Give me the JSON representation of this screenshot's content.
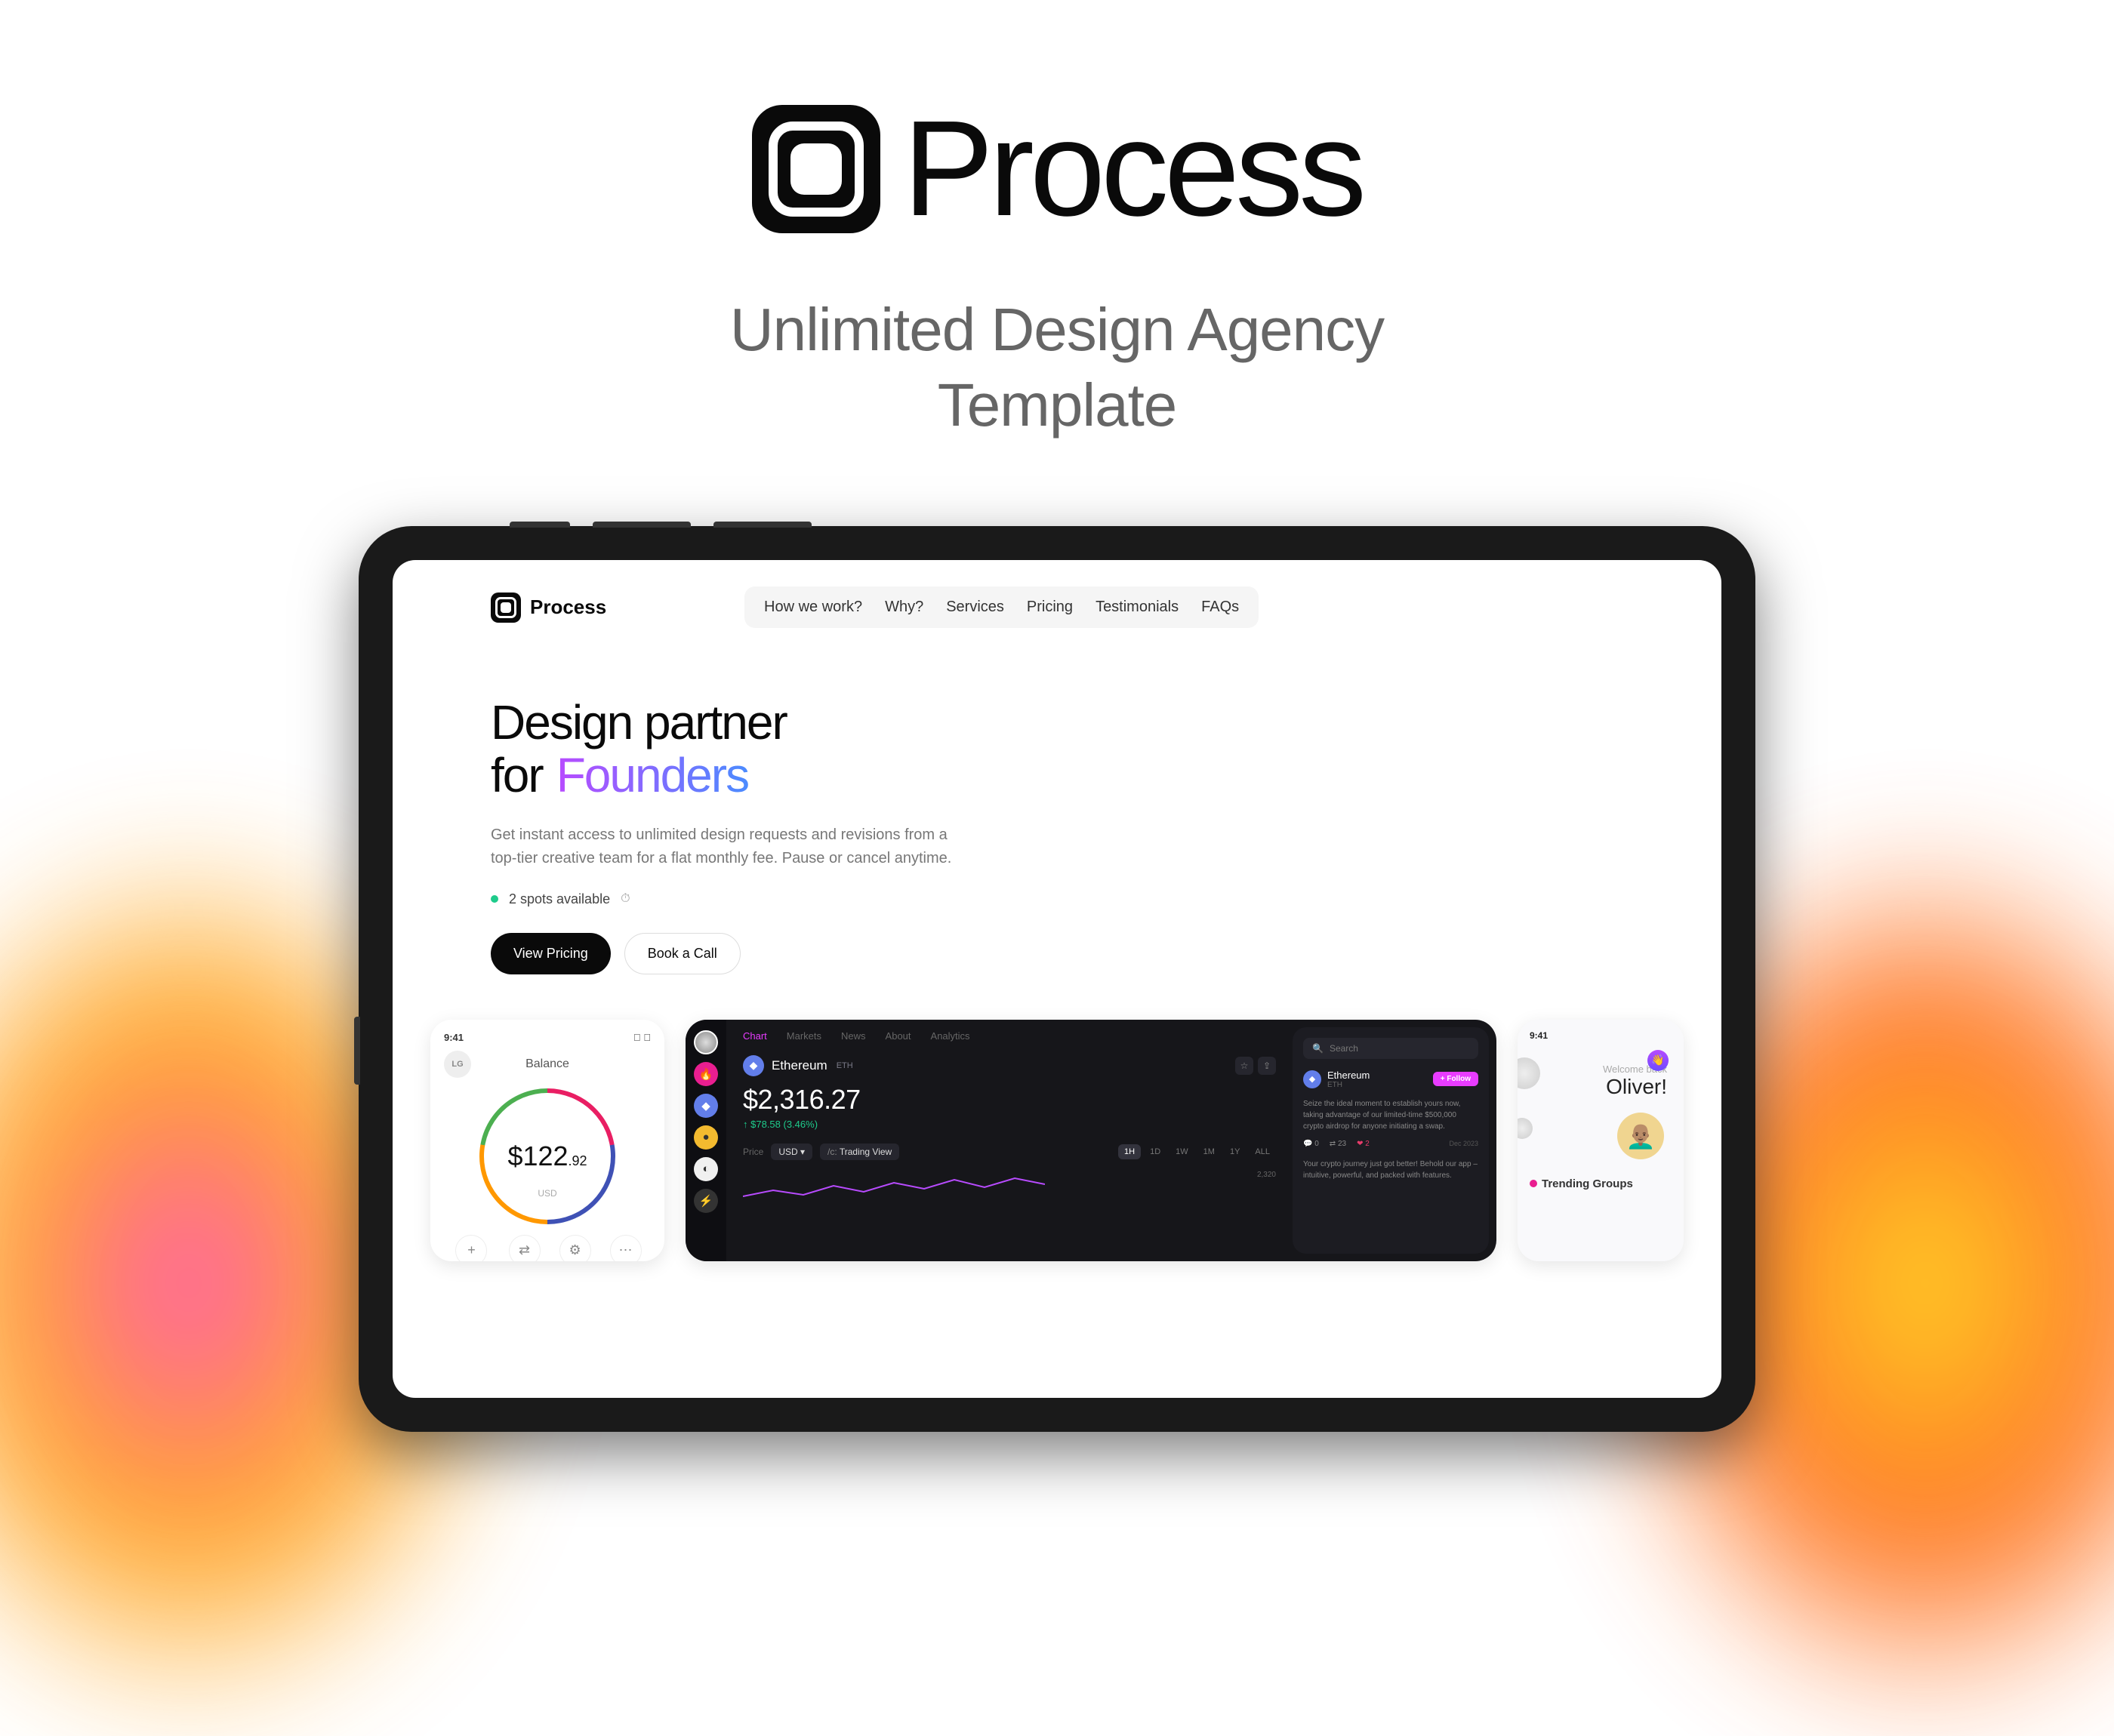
{
  "hero": {
    "brand": "Process",
    "subtitle_line1": "Unlimited Design Agency",
    "subtitle_line2": "Template"
  },
  "site": {
    "brand": "Process",
    "nav": [
      "How we work?",
      "Why?",
      "Services",
      "Pricing",
      "Testimonials",
      "FAQs"
    ],
    "headline_line1": "Design partner",
    "headline_for": "for",
    "headline_accent": "Founders",
    "description": "Get instant access to unlimited design requests and revisions from a top-tier creative team for a flat monthly fee. Pause or cancel anytime.",
    "spots": "2 spots available",
    "cta_primary": "View Pricing",
    "cta_secondary": "Book a Call"
  },
  "balance_card": {
    "time": "9:41",
    "avatar_initials": "LG",
    "label": "Balance",
    "amount_whole": "$122",
    "amount_cents": ".92",
    "currency": "USD",
    "actions": [
      {
        "icon": "+",
        "label": "Add money"
      },
      {
        "icon": "⇄",
        "label": "Exchange"
      },
      {
        "icon": "⚙",
        "label": "Settings"
      },
      {
        "icon": "⋯",
        "label": "More"
      }
    ]
  },
  "crypto_card": {
    "tabs": [
      "Chart",
      "Markets",
      "News",
      "About",
      "Analytics"
    ],
    "coin_name": "Ethereum",
    "coin_ticker": "ETH",
    "price": "$2,316.27",
    "change": "$78.58 (3.46%)",
    "price_label": "Price",
    "currency_chip": "USD",
    "compare_chip": "Trading View",
    "compare_prefix": "/c:",
    "range": [
      "1H",
      "1D",
      "1W",
      "1M",
      "1Y",
      "ALL"
    ],
    "range_active": "1H",
    "axis_val": "2,320",
    "search_placeholder": "Search",
    "side_name": "Ethereum",
    "side_ticker": "ETH",
    "follow_label": "+ Follow",
    "side_para": "Seize the ideal moment to establish yours now, taking advantage of our limited-time $500,000 crypto airdrop for anyone initiating a swap.",
    "stat_replies": "0",
    "stat_rt": "23",
    "stat_likes": "2",
    "side_date": "Dec 2023",
    "side_journey": "Your crypto journey just got better! Behold our app – intuitive, powerful, and packed with features."
  },
  "welcome_card": {
    "time": "9:41",
    "welcome_small": "Welcome back",
    "name": "Oliver!",
    "trending": "Trending Groups"
  }
}
